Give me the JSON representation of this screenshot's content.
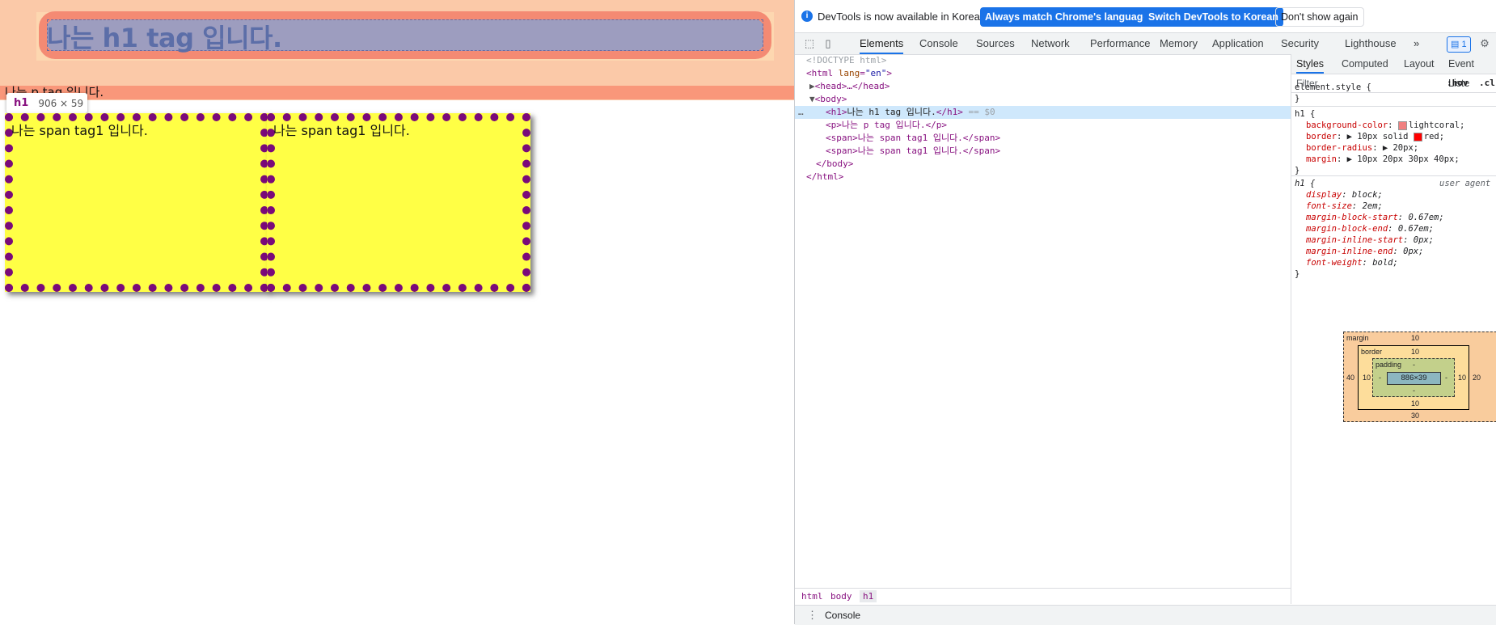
{
  "page": {
    "h1_text": "나는 h1 tag 입니다.",
    "p_text": "나는 p tag 입니다.",
    "span1_text": "나는 span tag1 입니다.",
    "span2_text": "나는 span tag1 입니다.",
    "tooltip": {
      "tag": "h1",
      "size": "906 × 59"
    }
  },
  "devtools": {
    "infobar": {
      "message": "DevTools is now available in Korean!",
      "btn_match": "Always match Chrome's language",
      "btn_switch": "Switch DevTools to Korean",
      "btn_dismiss": "Don't show again"
    },
    "tabs": [
      "Elements",
      "Console",
      "Sources",
      "Network",
      "Performance",
      "Memory",
      "Application",
      "Security",
      "Lighthouse"
    ],
    "more_tabs": "»",
    "issues_badge": "1",
    "dom": {
      "doctype": "<!DOCTYPE html>",
      "html_open_tag": "<html",
      "html_attr_name": "lang",
      "html_attr_value": "\"en\"",
      "html_open_end": ">",
      "head": "<head>…</head>",
      "body_open": "<body>",
      "h1_line_tag_open": "<h1>",
      "h1_line_text": "나는 h1 tag 입니다.",
      "h1_line_tag_close": "</h1>",
      "h1_line_suffix": " == $0",
      "p_line": "<p>나는 p tag 입니다.</p>",
      "span1_line": "<span>나는 span tag1 입니다.</span>",
      "span2_line": "<span>나는 span tag1 입니다.</span>",
      "body_close": "</body>",
      "html_close": "</html>",
      "ellipsis": "…"
    },
    "breadcrumbs": [
      "html",
      "body",
      "h1"
    ],
    "drawer_label": "Console",
    "styles": {
      "tabs": [
        "Styles",
        "Computed",
        "Layout",
        "Event Liste"
      ],
      "filter_placeholder": "Filter",
      "hov": ":hov",
      "cls": ".cl",
      "element_style": "element.style {",
      "close_brace": "}",
      "h1_selector": "h1 {",
      "h1_rules": [
        {
          "prop": "background-color",
          "value": "lightcoral;",
          "swatch": "#f08080"
        },
        {
          "prop": "border",
          "value": "10px solid",
          "value2": "red;",
          "swatch": "#ff0000"
        },
        {
          "prop": "border-radius",
          "value": "20px;"
        },
        {
          "prop": "margin",
          "value": "10px 20px 30px 40px;"
        }
      ],
      "ua_selector": "h1 {",
      "ua_label": "user agent",
      "ua_rules": [
        {
          "prop": "display",
          "value": "block;"
        },
        {
          "prop": "font-size",
          "value": "2em;"
        },
        {
          "prop": "margin-block-start",
          "value": "0.67em;"
        },
        {
          "prop": "margin-block-end",
          "value": "0.67em;"
        },
        {
          "prop": "margin-inline-start",
          "value": "0px;"
        },
        {
          "prop": "margin-inline-end",
          "value": "0px;"
        },
        {
          "prop": "font-weight",
          "value": "bold;"
        }
      ]
    },
    "box_model": {
      "margin_label": "margin",
      "margin_top": "10",
      "margin_bottom": "30",
      "margin_left": "40",
      "margin_right": "20",
      "border_label": "border",
      "border_top": "10",
      "border_bottom": "10",
      "border_left": "10",
      "border_right": "10",
      "padding_label": "padding",
      "padding_top": "-",
      "padding_bottom": "-",
      "padding_left": "-",
      "padding_right": "-",
      "content": "886×39"
    }
  }
}
